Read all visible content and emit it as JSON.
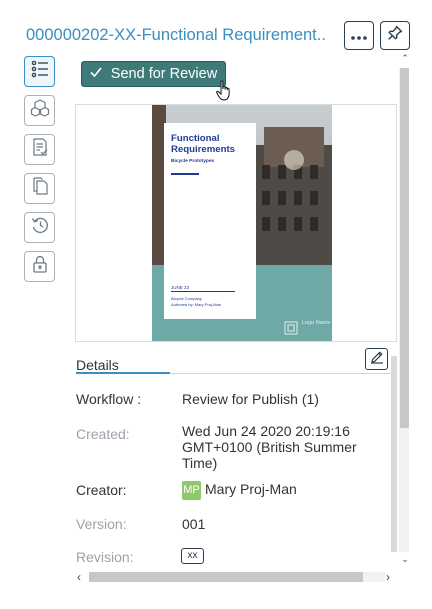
{
  "header": {
    "title": "000000202-XX-Functional Requirement...",
    "more_icon": "ellipsis-icon",
    "pin_icon": "pin-icon"
  },
  "toolbar": {
    "send_label": "Send for Review",
    "send_icon": "checkmark-icon"
  },
  "sidebar_tools": [
    "checklist-icon",
    "cubes-icon",
    "document-check-icon",
    "copy-icon",
    "history-icon",
    "lock-icon"
  ],
  "preview": {
    "title": "Functional Requirements",
    "subtitle": "Bicycle Prototypes",
    "date": "JUNE 23",
    "company": "Bicycle Company",
    "author": "Authored by: Mary Proj-Man",
    "logo_text": "Logo Name"
  },
  "details": {
    "tab_label": "Details",
    "edit_icon": "pencil-icon",
    "workflow_label": "Workflow :",
    "workflow_value": "Review for Publish (1)",
    "created_label": "Created:",
    "created_value": "Wed Jun 24 2020 20:19:16 GMT+0100 (British Summer Time)",
    "creator_label": "Creator:",
    "creator_initials": "MP",
    "creator_name": "Mary Proj-Man",
    "version_label": "Version:",
    "version_value": "001",
    "revision_label": "Revision:",
    "revision_value": "xx"
  },
  "colors": {
    "accent": "#3a8fc0",
    "button_bg": "#3e7a78",
    "avatar_bg": "#8fc86a",
    "text_dark": "#333333",
    "text_muted": "#9ba3ab"
  }
}
